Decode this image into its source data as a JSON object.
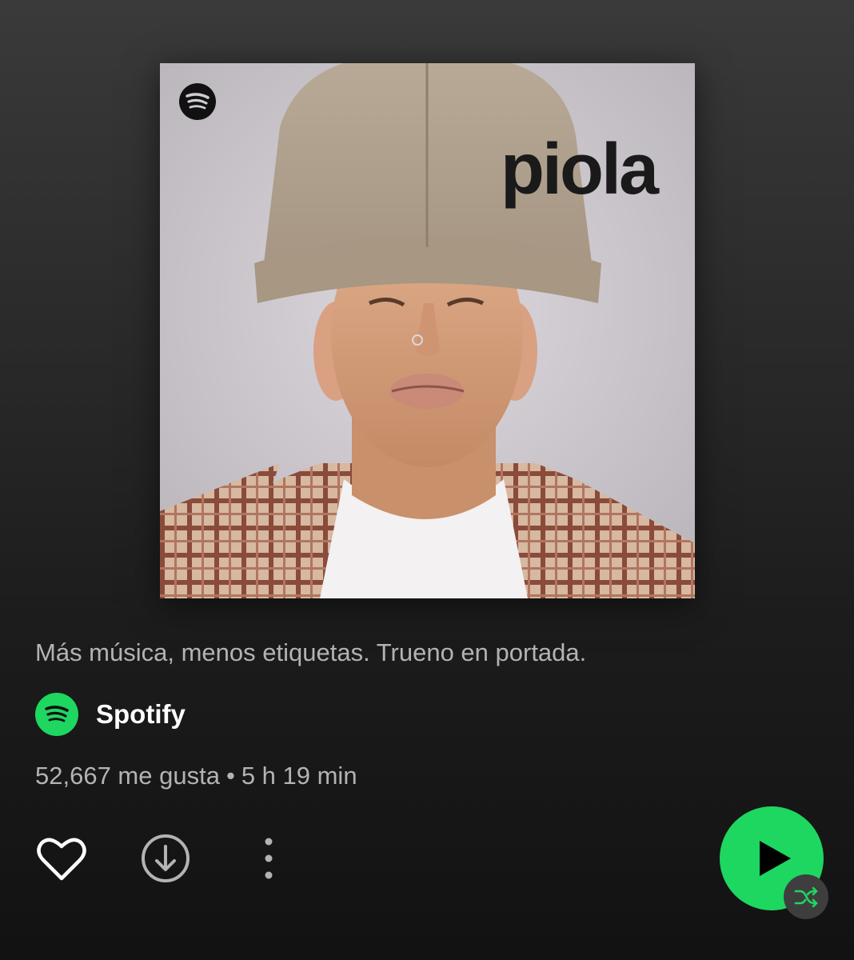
{
  "cover": {
    "title": "piola",
    "logo_icon": "spotify-logo-icon"
  },
  "playlist": {
    "description": "Más música, menos etiquetas. Trueno en portada.",
    "owner": {
      "name": "Spotify",
      "avatar_icon": "spotify-logo-icon"
    },
    "likes": "52,667 me gusta",
    "separator": "•",
    "duration": "5 h 19 min"
  },
  "actions": {
    "like_icon": "heart-icon",
    "download_icon": "download-icon",
    "more_icon": "more-options-icon",
    "play_icon": "play-icon",
    "shuffle_icon": "shuffle-icon"
  },
  "colors": {
    "accent": "#1ed760",
    "text_primary": "#ffffff",
    "text_secondary": "#b3b3b3",
    "badge": "#3e3e3e"
  }
}
